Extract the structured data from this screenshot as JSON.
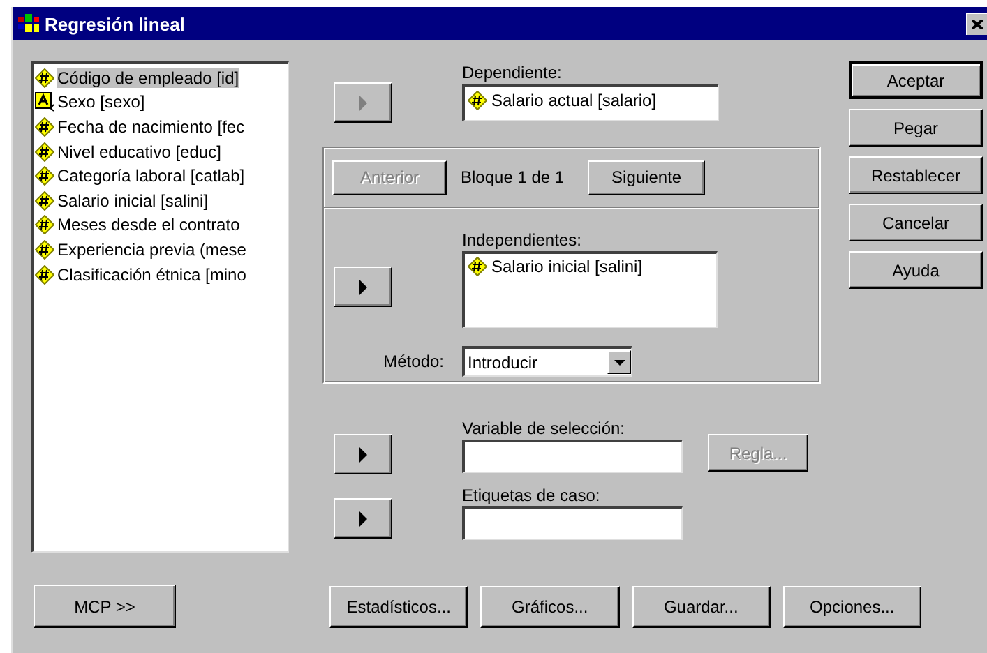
{
  "window": {
    "title": "Regresión lineal"
  },
  "variables": [
    {
      "label": "Código de empleado [id]",
      "kind": "numeric",
      "selected": true
    },
    {
      "label": "Sexo [sexo]",
      "kind": "string",
      "selected": false
    },
    {
      "label": "Fecha de nacimiento [fec",
      "kind": "numeric",
      "selected": false
    },
    {
      "label": "Nivel educativo [educ]",
      "kind": "numeric",
      "selected": false
    },
    {
      "label": "Categoría laboral [catlab]",
      "kind": "numeric",
      "selected": false
    },
    {
      "label": "Salario inicial [salini]",
      "kind": "numeric",
      "selected": false
    },
    {
      "label": "Meses desde el contrato",
      "kind": "numeric",
      "selected": false
    },
    {
      "label": "Experiencia previa (mese",
      "kind": "numeric",
      "selected": false
    },
    {
      "label": "Clasificación étnica [mino",
      "kind": "numeric",
      "selected": false
    }
  ],
  "dependent": {
    "label": "Dependiente:",
    "arrow_disabled": true,
    "items": [
      {
        "label": "Salario actual [salario]",
        "kind": "numeric"
      }
    ]
  },
  "block": {
    "previous": {
      "label": "Anterior",
      "disabled": true
    },
    "caption": "Bloque 1 de 1",
    "next": {
      "label": "Siguiente",
      "disabled": false
    }
  },
  "independents": {
    "label": "Independientes:",
    "arrow_disabled": false,
    "items": [
      {
        "label": "Salario inicial [salini]",
        "kind": "numeric"
      }
    ]
  },
  "method": {
    "label": "Método:",
    "value": "Introducir"
  },
  "selection_variable": {
    "label": "Variable de selección:",
    "arrow_disabled": false,
    "rule": {
      "label": "Regla...",
      "disabled": true
    }
  },
  "case_labels": {
    "label": "Etiquetas de caso:",
    "arrow_disabled": false
  },
  "side_buttons": [
    {
      "label": "Aceptar",
      "default": true
    },
    {
      "label": "Pegar",
      "default": false
    },
    {
      "label": "Restablecer",
      "default": false
    },
    {
      "label": "Cancelar",
      "default": false
    },
    {
      "label": "Ayuda",
      "default": false
    }
  ],
  "mcp_button": "MCP >>",
  "bottom_buttons": [
    "Estadísticos...",
    "Gráficos...",
    "Guardar...",
    "Opciones..."
  ]
}
